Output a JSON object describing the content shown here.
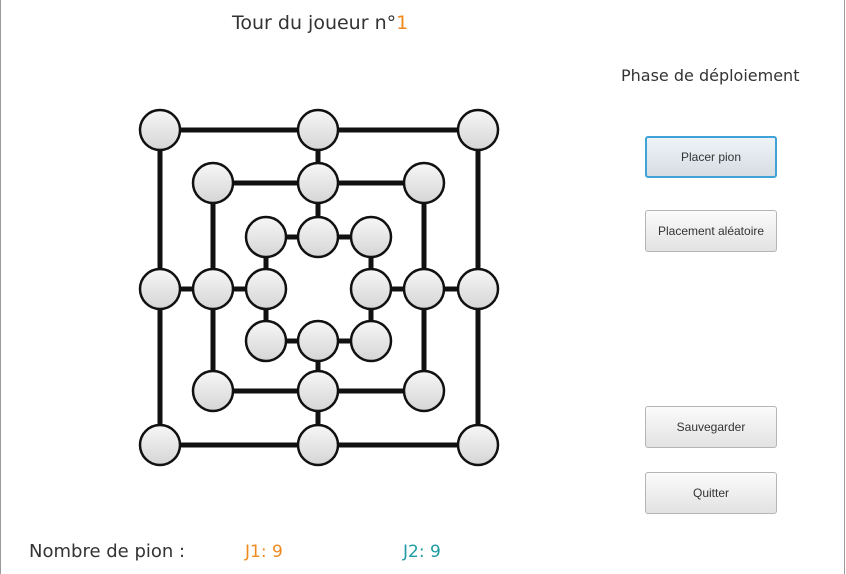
{
  "header": {
    "turn_label": "Tour du joueur n°",
    "turn_player": "1"
  },
  "phase_label": "Phase de déploiement",
  "buttons": {
    "place": "Placer pion",
    "random": "Placement aléatoire",
    "save": "Sauvegarder",
    "quit": "Quitter"
  },
  "footer": {
    "label": "Nombre de pion :",
    "j1": "J1: 9",
    "j2": "J2: 9"
  },
  "colors": {
    "player1": "#ef8a1e",
    "player2": "#1e9aa3",
    "focus": "#3fa3d8"
  },
  "board": {
    "rings": 3,
    "points_per_ring": 8,
    "occupied": []
  }
}
